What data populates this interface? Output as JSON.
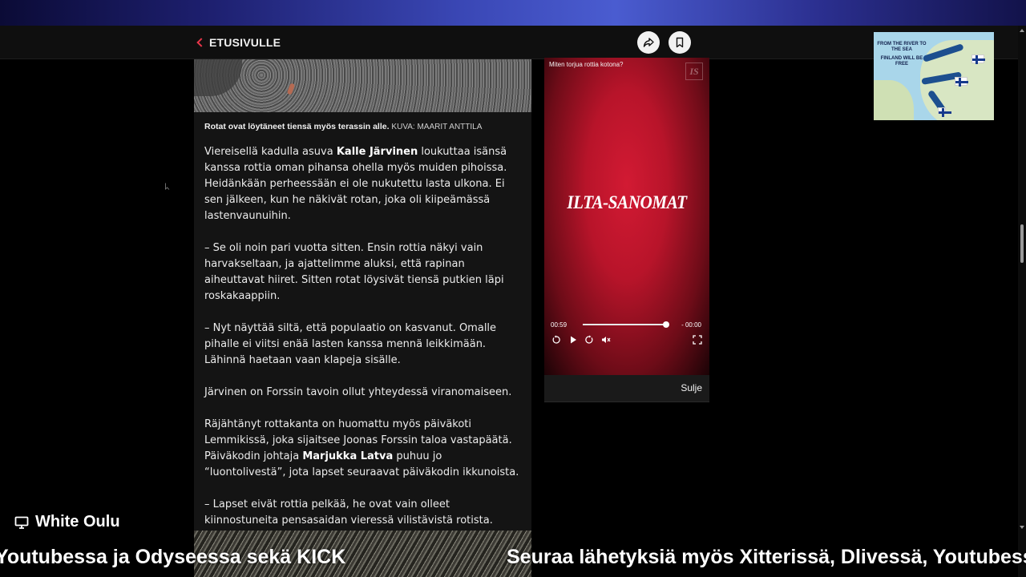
{
  "navbar": {
    "back_label": "ETUSIVULLE"
  },
  "article": {
    "caption": "Rotat ovat löytäneet tiensä myös terassin alle.",
    "caption_credit": "KUVA: MAARIT ANTTILA",
    "paragraphs": [
      {
        "before": "Viereisellä kadulla asuva ",
        "bold": "Kalle Järvinen",
        "after": " loukuttaa isänsä kanssa rottia oman pihansa ohella myös muiden pihoissa. Heidänkään perheessään ei ole nukutettu lasta ulkona. Ei sen jälkeen, kun he näkivät rotan, joka oli kiipeämässä lastenvaunuihin."
      },
      {
        "before": "– Se oli noin pari vuotta sitten. Ensin rottia näkyi vain harvakseltaan, ja ajattelimme aluksi, että rapinan aiheuttavat hiiret. Sitten rotat löysivät tiensä putkien läpi roskakaappiin.",
        "bold": "",
        "after": ""
      },
      {
        "before": "– Nyt näyttää siltä, että populaatio on kasvanut. Omalle pihalle ei viitsi enää lasten kanssa mennä leikkimään. Lähinnä haetaan vaan klapeja sisälle.",
        "bold": "",
        "after": ""
      },
      {
        "before": "Järvinen on Forssin tavoin ollut yhteydessä viranomaiseen.",
        "bold": "",
        "after": ""
      },
      {
        "before": "Räjähtänyt rottakanta on huomattu myös päiväkoti Lemmikissä, joka sijaitsee Joonas Forssin taloa vastapäätä. Päiväkodin johtaja ",
        "bold": "Marjukka Latva",
        "after": " puhuu jo “luontolivestä”, jota lapset seuraavat päiväkodin ikkunoista."
      },
      {
        "before": "– Lapset eivät rottia pelkää, he ovat vain olleet kiinnostuneita pensasaidan vieressä vilistävistä rotista.",
        "bold": "",
        "after": ""
      }
    ]
  },
  "video": {
    "title": "Miten torjua rottia kotona?",
    "logo": "IS",
    "brand": "ILTA-SANOMAT",
    "time_current": "00:59",
    "time_end": "- 00:00",
    "progress": 0.98,
    "close_label": "Sulje"
  },
  "map_thumbnail": {
    "line1": "FROM THE RIVER TO THE SEA",
    "line2": "FINLAND WILL BE FREE"
  },
  "stream": {
    "channel": "White Oulu",
    "ticker_left": "Youtubessa ja Odyseessa sekä KICK",
    "ticker_right": "Seuraa lähetyksiä myös Xitterissä, Dlivessä, Youtubessa"
  },
  "colors": {
    "accent_red": "#e8364a",
    "video_red": "#c8152d",
    "background": "#000000"
  }
}
